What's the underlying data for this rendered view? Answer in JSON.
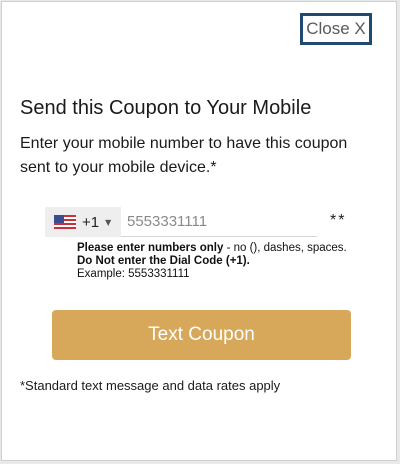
{
  "close_button": {
    "label": "Close X"
  },
  "title": "Send this Coupon to Your Mobile",
  "description": "Enter your mobile number to have this coupon sent to your mobile device.*",
  "phone": {
    "country_flag": "us-flag-icon",
    "dial_code": "+1",
    "placeholder": "5553331111",
    "value": "",
    "required_mark": "**"
  },
  "help": {
    "line1_bold": "Please enter numbers only",
    "line1_rest": " - no (), dashes, spaces.",
    "line2": "Do Not enter the Dial Code (+1).",
    "line3": "Example: 5553331111"
  },
  "submit_button": {
    "label": "Text Coupon"
  },
  "footnote": "*Standard text message and data rates apply",
  "colors": {
    "accent_button": "#d8a85a",
    "close_border": "#1f4a71"
  }
}
